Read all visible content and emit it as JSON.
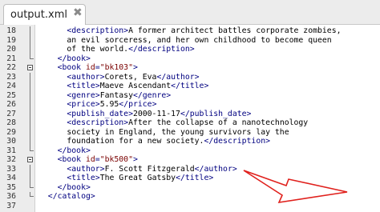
{
  "tab": {
    "title": "output.xml",
    "close": "✖"
  },
  "lines": [
    {
      "n": "18",
      "indent": 3,
      "fold": "bar",
      "segs": [
        {
          "t": "tag",
          "v": "<description>"
        },
        {
          "t": "text",
          "v": "A former architect battles corporate zombies,"
        }
      ]
    },
    {
      "n": "19",
      "indent": 3,
      "fold": "bar",
      "segs": [
        {
          "t": "text",
          "v": "an evil sorceress, and her own childhood to become queen"
        }
      ]
    },
    {
      "n": "20",
      "indent": 3,
      "fold": "bar",
      "segs": [
        {
          "t": "text",
          "v": "of the world."
        },
        {
          "t": "tag",
          "v": "</description>"
        }
      ]
    },
    {
      "n": "21",
      "indent": 2,
      "fold": "end",
      "segs": [
        {
          "t": "tag",
          "v": "</book>"
        }
      ]
    },
    {
      "n": "22",
      "indent": 2,
      "fold": "box",
      "segs": [
        {
          "t": "tag",
          "v": "<book "
        },
        {
          "t": "attr",
          "v": "id"
        },
        {
          "t": "tag",
          "v": "="
        },
        {
          "t": "val",
          "v": "\"bk103\""
        },
        {
          "t": "tag",
          "v": ">"
        }
      ]
    },
    {
      "n": "23",
      "indent": 3,
      "fold": "bar",
      "segs": [
        {
          "t": "tag",
          "v": "<author>"
        },
        {
          "t": "text",
          "v": "Corets, Eva"
        },
        {
          "t": "tag",
          "v": "</author>"
        }
      ]
    },
    {
      "n": "24",
      "indent": 3,
      "fold": "bar",
      "segs": [
        {
          "t": "tag",
          "v": "<title>"
        },
        {
          "t": "text",
          "v": "Maeve Ascendant"
        },
        {
          "t": "tag",
          "v": "</title>"
        }
      ]
    },
    {
      "n": "25",
      "indent": 3,
      "fold": "bar",
      "segs": [
        {
          "t": "tag",
          "v": "<genre>"
        },
        {
          "t": "text",
          "v": "Fantasy"
        },
        {
          "t": "tag",
          "v": "</genre>"
        }
      ]
    },
    {
      "n": "26",
      "indent": 3,
      "fold": "bar",
      "segs": [
        {
          "t": "tag",
          "v": "<price>"
        },
        {
          "t": "text",
          "v": "5.95"
        },
        {
          "t": "tag",
          "v": "</price>"
        }
      ]
    },
    {
      "n": "27",
      "indent": 3,
      "fold": "bar",
      "segs": [
        {
          "t": "tag",
          "v": "<publish_date>"
        },
        {
          "t": "text",
          "v": "2000-11-17"
        },
        {
          "t": "tag",
          "v": "</publish_date>"
        }
      ]
    },
    {
      "n": "28",
      "indent": 3,
      "fold": "bar",
      "segs": [
        {
          "t": "tag",
          "v": "<description>"
        },
        {
          "t": "text",
          "v": "After the collapse of a nanotechnology"
        }
      ]
    },
    {
      "n": "29",
      "indent": 3,
      "fold": "bar",
      "segs": [
        {
          "t": "text",
          "v": "society in England, the young survivors lay the"
        }
      ]
    },
    {
      "n": "30",
      "indent": 3,
      "fold": "bar",
      "segs": [
        {
          "t": "text",
          "v": "foundation for a new society."
        },
        {
          "t": "tag",
          "v": "</description>"
        }
      ]
    },
    {
      "n": "31",
      "indent": 2,
      "fold": "end",
      "segs": [
        {
          "t": "tag",
          "v": "</book>"
        }
      ]
    },
    {
      "n": "32",
      "indent": 2,
      "fold": "box",
      "segs": [
        {
          "t": "tag",
          "v": "<book "
        },
        {
          "t": "attr",
          "v": "id"
        },
        {
          "t": "tag",
          "v": "="
        },
        {
          "t": "val",
          "v": "\"bk500\""
        },
        {
          "t": "tag",
          "v": ">"
        }
      ]
    },
    {
      "n": "33",
      "indent": 3,
      "fold": "bar",
      "segs": [
        {
          "t": "tag",
          "v": "<author>"
        },
        {
          "t": "text",
          "v": "F. Scott Fitzgerald"
        },
        {
          "t": "tag",
          "v": "</author>"
        }
      ]
    },
    {
      "n": "34",
      "indent": 3,
      "fold": "bar",
      "segs": [
        {
          "t": "tag",
          "v": "<title>"
        },
        {
          "t": "text",
          "v": "The Great Gatsby"
        },
        {
          "t": "tag",
          "v": "</title>"
        }
      ]
    },
    {
      "n": "35",
      "indent": 2,
      "fold": "end",
      "segs": [
        {
          "t": "tag",
          "v": "</book>"
        }
      ]
    },
    {
      "n": "36",
      "indent": 1,
      "fold": "end",
      "segs": [
        {
          "t": "tag",
          "v": "</catalog>"
        }
      ]
    },
    {
      "n": "37",
      "indent": 0,
      "fold": "none",
      "segs": []
    }
  ],
  "colors": {
    "annotation_arrow": "#e0201c",
    "tag": "#000080",
    "attribute": "#7a0000"
  }
}
